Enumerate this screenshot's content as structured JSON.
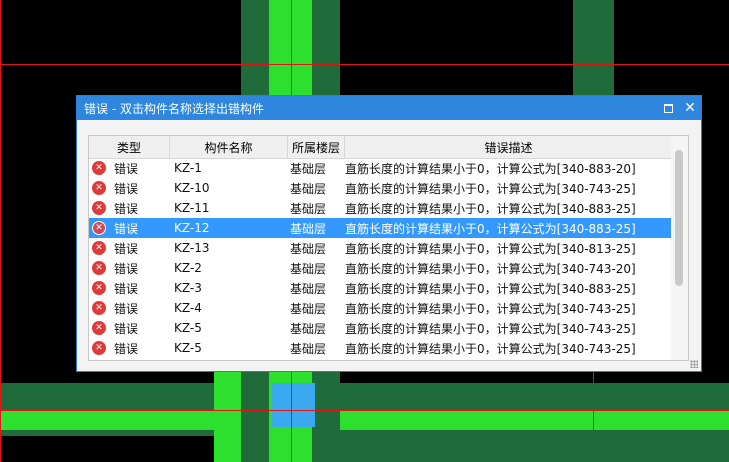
{
  "dialog": {
    "title": "错误 - 双击构件名称选择出错构件",
    "maximize_icon": "maximize-icon",
    "close_glyph": "✕"
  },
  "table": {
    "headers": [
      "类型",
      "构件名称",
      "所属楼层",
      "错误描述"
    ],
    "rows": [
      {
        "type": "错误",
        "name": "KZ-1",
        "floor": "基础层",
        "desc": "直筋长度的计算结果小于0，计算公式为[340-883-20]",
        "selected": false
      },
      {
        "type": "错误",
        "name": "KZ-10",
        "floor": "基础层",
        "desc": "直筋长度的计算结果小于0，计算公式为[340-743-25]",
        "selected": false
      },
      {
        "type": "错误",
        "name": "KZ-11",
        "floor": "基础层",
        "desc": "直筋长度的计算结果小于0，计算公式为[340-883-25]",
        "selected": false
      },
      {
        "type": "错误",
        "name": "KZ-12",
        "floor": "基础层",
        "desc": "直筋长度的计算结果小于0，计算公式为[340-883-25]",
        "selected": true
      },
      {
        "type": "错误",
        "name": "KZ-13",
        "floor": "基础层",
        "desc": "直筋长度的计算结果小于0，计算公式为[340-813-25]",
        "selected": false
      },
      {
        "type": "错误",
        "name": "KZ-2",
        "floor": "基础层",
        "desc": "直筋长度的计算结果小于0，计算公式为[340-743-20]",
        "selected": false
      },
      {
        "type": "错误",
        "name": "KZ-3",
        "floor": "基础层",
        "desc": "直筋长度的计算结果小于0，计算公式为[340-883-25]",
        "selected": false
      },
      {
        "type": "错误",
        "name": "KZ-4",
        "floor": "基础层",
        "desc": "直筋长度的计算结果小于0，计算公式为[340-743-25]",
        "selected": false
      },
      {
        "type": "错误",
        "name": "KZ-5",
        "floor": "基础层",
        "desc": "直筋长度的计算结果小于0，计算公式为[340-743-25]",
        "selected": false
      },
      {
        "type": "错误",
        "name": "KZ-5",
        "floor": "基础层",
        "desc": "直筋长度的计算结果小于0，计算公式为[340-743-25]",
        "selected": false
      }
    ]
  },
  "colors": {
    "titlebar": "#2e86de",
    "selected_row": "#3399ff",
    "error_icon": "#e03a3a",
    "cad_dark_green": "#1f6b3a",
    "cad_bright_green": "#2ee02e",
    "cad_red_line": "#e01515"
  }
}
